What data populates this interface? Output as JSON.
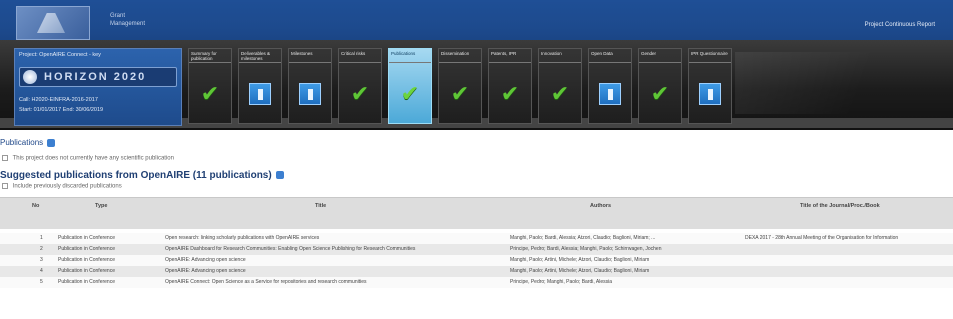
{
  "header": {
    "brand_line1": "Grant",
    "brand_line2": "Management",
    "report_link": "Project Continuous Report"
  },
  "project": {
    "line1": "Project: OpenAIRE Connect  -  key",
    "logo_word": "HORIZON 2020",
    "line3": "Call: H2020-EINFRA-2016-2017",
    "line4": "Start: 01/01/2017   End: 30/06/2019"
  },
  "steps": [
    {
      "label": "Summary for publication",
      "icon": "check-icon",
      "active": false
    },
    {
      "label": "Deliverables & milestones",
      "icon": "document-icon",
      "active": false
    },
    {
      "label": "Milestones",
      "icon": "document-icon",
      "active": false
    },
    {
      "label": "Critical risks",
      "icon": "check-icon",
      "active": false
    },
    {
      "label": "Publications",
      "icon": "check-icon",
      "active": true
    },
    {
      "label": "Dissemination",
      "icon": "check-icon",
      "active": false
    },
    {
      "label": "Patents, IPR",
      "icon": "check-icon",
      "active": false
    },
    {
      "label": "Innovation",
      "icon": "check-icon",
      "active": false
    },
    {
      "label": "Open Data",
      "icon": "document-icon",
      "active": false
    },
    {
      "label": "Gender",
      "icon": "check-icon",
      "active": false
    },
    {
      "label": "IPR Questionnaire",
      "icon": "document-icon",
      "active": false
    }
  ],
  "publications": {
    "heading": "Publications",
    "no_pubs_checkbox": "This project does not currently have any scientific publication",
    "suggested_heading": "Suggested publications from OpenAIRE (11 publications)",
    "include_checkbox": "Include previously discarded publications"
  },
  "table": {
    "headers": [
      "No",
      "Type",
      "Title",
      "Authors",
      "Title of the Journal/Proc./Book"
    ],
    "rows": [
      {
        "no": "1",
        "type": "Publication in Conference",
        "title": "Open research: linking scholarly publications with OpenAIRE services",
        "authors": "Manghi, Paolo; Bardi, Alessia; Atzori, Claudio; Baglioni, Miriam; ...",
        "journal": "DEXA 2017 - 28th Annual Meeting of the Organisation for Information"
      },
      {
        "no": "2",
        "type": "Publication in Conference",
        "title": "OpenAIRE Dashboard for Research Communities: Enabling Open Science Publishing for Research Communities",
        "authors": "Principe, Pedro; Bardi, Alessia; Manghi, Paolo; Schirrwagen, Jochen",
        "journal": ""
      },
      {
        "no": "3",
        "type": "Publication in Conference",
        "title": "OpenAIRE: Advancing open science",
        "authors": "Manghi, Paolo; Artini, Michele; Atzori, Claudio; Baglioni, Miriam",
        "journal": ""
      },
      {
        "no": "4",
        "type": "Publication in Conference",
        "title": "OpenAIRE: Advancing open science",
        "authors": "Manghi, Paolo; Artini, Michele; Atzori, Claudio; Baglioni, Miriam",
        "journal": ""
      },
      {
        "no": "5",
        "type": "Publication in Conference",
        "title": "OpenAIRE Connect: Open Science as a Service for repositories and research communities",
        "authors": "Principe, Pedro; Manghi, Paolo; Bardi, Alessia",
        "journal": ""
      }
    ]
  }
}
